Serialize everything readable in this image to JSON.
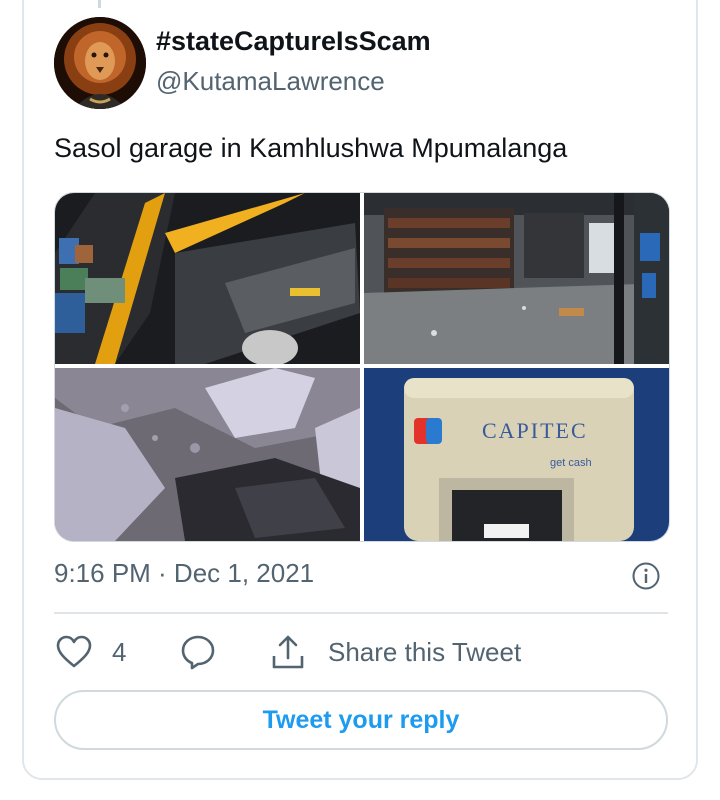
{
  "tweet": {
    "display_name": "#stateCaptureIsScam",
    "handle": "@KutamaLawrence",
    "text": "Sasol garage in Kamhlushwa Mpumalanga",
    "timestamp": "9:16 PM · Dec 1, 2021",
    "likes": "4",
    "share_label": "Share this Tweet",
    "reply_prompt": "Tweet your reply"
  },
  "media": {
    "atm_brand": "CAPITEC",
    "atm_tagline": "get cash"
  },
  "colors": {
    "accent": "#1d9bf0",
    "text_secondary": "#536471",
    "border": "#cfd9de"
  },
  "icons": [
    "avatar-lion",
    "info-icon",
    "heart-icon",
    "reply-bubble-icon",
    "share-upload-icon"
  ]
}
